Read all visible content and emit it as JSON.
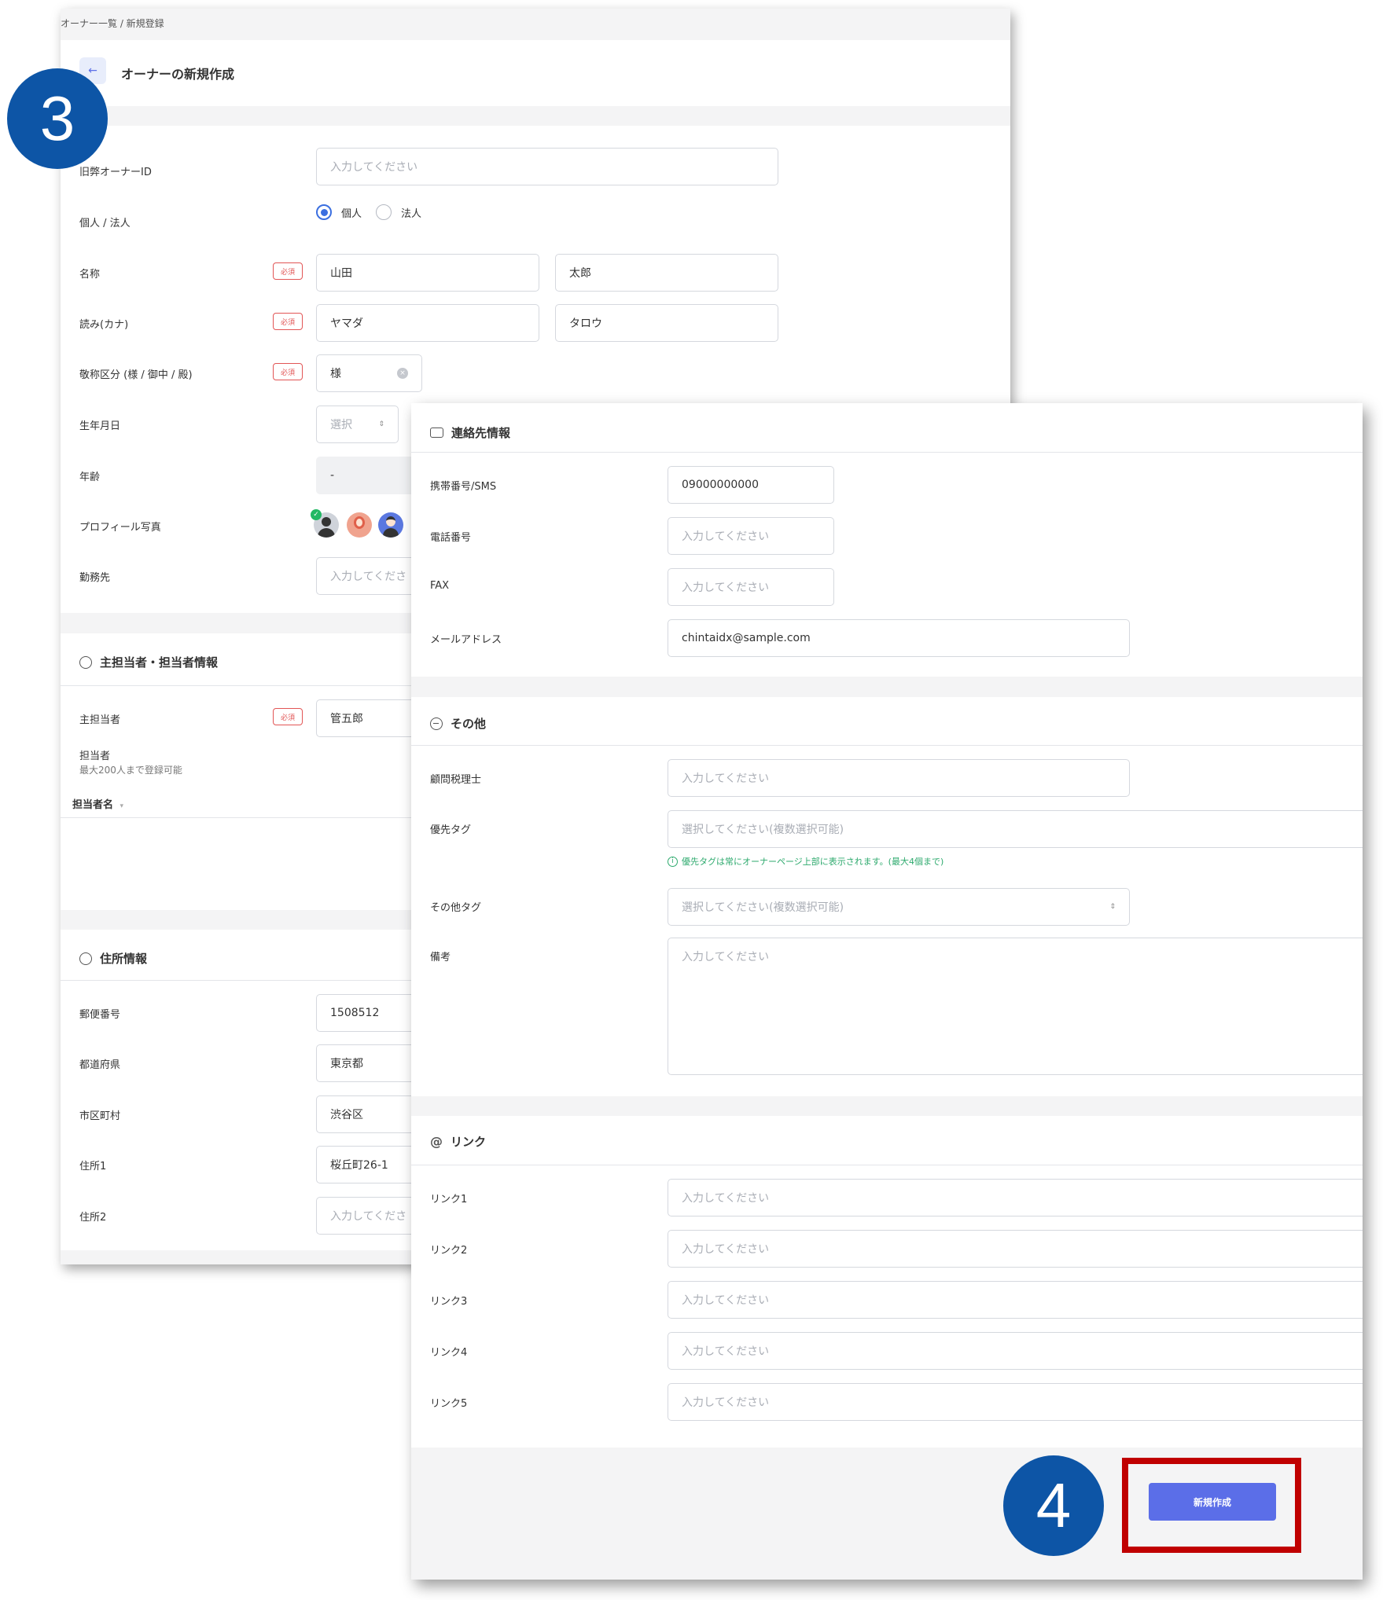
{
  "screen1": {
    "breadcrumb": "オーナー一覧 / 新規登録",
    "page_title": "オーナーの新規作成",
    "back_icon": "←",
    "required_badge": "必須",
    "fields": {
      "old_owner_id": {
        "label": "旧弊オーナーID",
        "placeholder": "入力してください"
      },
      "type": {
        "label": "個人 / 法人",
        "options": [
          "個人",
          "法人"
        ],
        "selected": "個人"
      },
      "name": {
        "label": "名称",
        "last": "山田",
        "first": "太郎"
      },
      "kana": {
        "label": "読み(カナ)",
        "last": "ヤマダ",
        "first": "タロウ"
      },
      "honorific": {
        "label": "敬称区分 (様 / 御中 / 殿)",
        "value": "様"
      },
      "birthday": {
        "label": "生年月日",
        "placeholder": "選択"
      },
      "age": {
        "label": "年齢",
        "value": "-"
      },
      "profile_photo": {
        "label": "プロフィール写真"
      },
      "workplace": {
        "label": "勤務先",
        "placeholder": "入力してくださ"
      }
    },
    "staff_section": {
      "title": "主担当者・担当者情報",
      "main_staff_label": "主担当者",
      "main_staff_value": "管五郎",
      "staff_label": "担当者",
      "staff_note": "最大200人まで登録可能",
      "column_header": "担当者名"
    },
    "address_section": {
      "title": "住所情報",
      "rows": [
        {
          "label": "郵便番号",
          "value": "1508512"
        },
        {
          "label": "都道府県",
          "value": "東京都"
        },
        {
          "label": "市区町村",
          "value": "渋谷区"
        },
        {
          "label": "住所1",
          "value": "桜丘町26-1"
        },
        {
          "label": "住所2",
          "value": "入力してくださ"
        }
      ]
    }
  },
  "screen2": {
    "contact_section": {
      "title": "連絡先情報",
      "rows": [
        {
          "label": "携帯番号/SMS",
          "value": "09000000000"
        },
        {
          "label": "電話番号",
          "value": "入力してください"
        },
        {
          "label": "FAX",
          "value": "入力してください"
        },
        {
          "label": "メールアドレス",
          "value": "chintaidx@sample.com"
        }
      ]
    },
    "other_section": {
      "title": "その他",
      "tax_label": "顧問税理士",
      "tax_placeholder": "入力してください",
      "priority_tag_label": "優先タグ",
      "priority_tag_placeholder": "選択してください(複数選択可能)",
      "priority_tag_hint": "優先タグは常にオーナーページ上部に表示されます。(最大4個まで)",
      "other_tag_label": "その他タグ",
      "other_tag_placeholder": "選択してください(複数選択可能)",
      "memo_label": "備考",
      "memo_placeholder": "入力してください"
    },
    "link_section": {
      "title": "リンク",
      "rows": [
        {
          "label": "リンク1",
          "placeholder": "入力してください"
        },
        {
          "label": "リンク2",
          "placeholder": "入力してください"
        },
        {
          "label": "リンク3",
          "placeholder": "入力してください"
        },
        {
          "label": "リンク4",
          "placeholder": "入力してください"
        },
        {
          "label": "リンク5",
          "placeholder": "入力してください"
        }
      ]
    },
    "submit_button": "新規作成"
  },
  "callouts": {
    "step3": "3",
    "step4": "4"
  },
  "colors": {
    "badge": "#0d55a6",
    "primary_button": "#5b6ee8",
    "highlight": "#c00000",
    "required": "#e25555",
    "hint": "#2eaa6e"
  }
}
